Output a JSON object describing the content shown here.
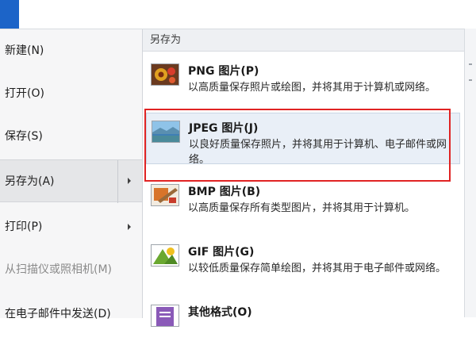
{
  "left_menu": [
    {
      "label": "新建(N)"
    },
    {
      "label": "打开(O)"
    },
    {
      "label": "保存(S)"
    },
    {
      "label": "另存为(A)"
    },
    {
      "label": "打印(P)"
    },
    {
      "label": "从扫描仪或照相机(M)"
    },
    {
      "label": "在电子邮件中发送(D)"
    }
  ],
  "save_as": {
    "header": "另存为",
    "items": [
      {
        "title": "PNG 图片(P)",
        "description": "以高质量保存照片或绘图，并将其用于计算机或网络。",
        "icon": "png-image-icon"
      },
      {
        "title": "JPEG 图片(J)",
        "description": "以良好质量保存照片，并将其用于计算机、电子邮件或网络。",
        "icon": "jpeg-image-icon"
      },
      {
        "title": "BMP 图片(B)",
        "description": "以高质量保存所有类型图片，并将其用于计算机。",
        "icon": "bmp-image-icon"
      },
      {
        "title": "GIF 图片(G)",
        "description": "以较低质量保存简单绘图，并将其用于电子邮件或网络。",
        "icon": "gif-image-icon"
      },
      {
        "title": "其他格式(O)",
        "description": "",
        "icon": "other-formats-icon"
      }
    ]
  },
  "colors": {
    "accent": "#1c64c8",
    "highlight_border": "#e02323",
    "hover_background": "#e9eff7"
  }
}
